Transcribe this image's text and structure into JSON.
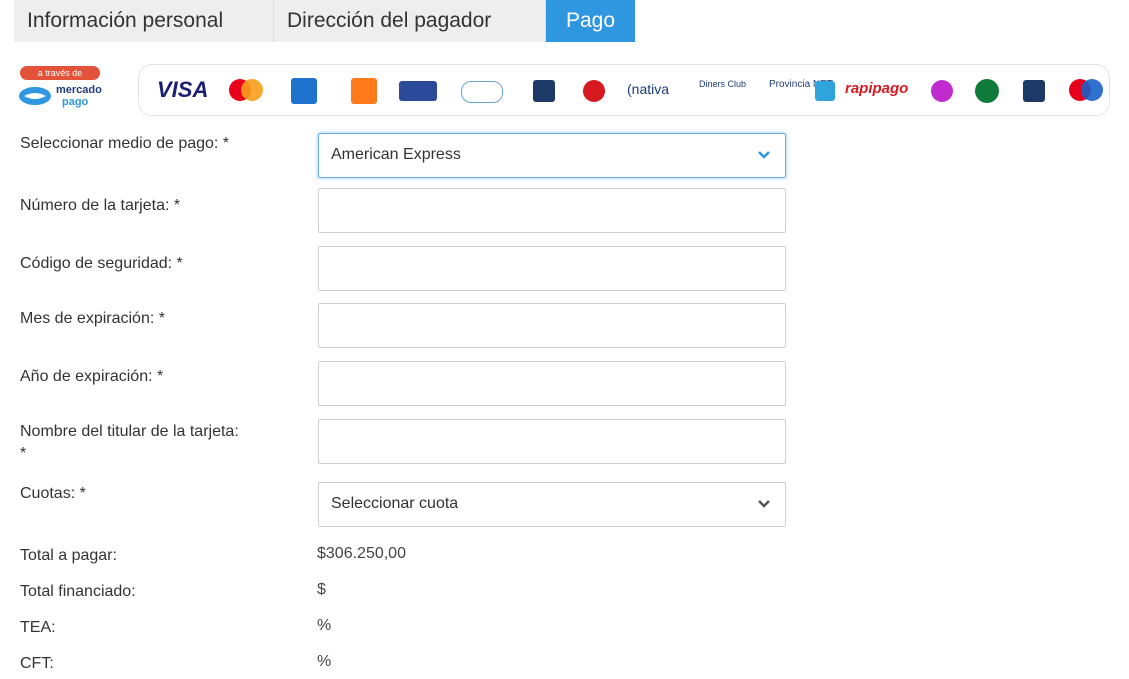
{
  "tabs": [
    {
      "label": "Información personal",
      "active": false
    },
    {
      "label": "Dirección del pagador",
      "active": false
    },
    {
      "label": "Pago",
      "active": true
    }
  ],
  "payment_logos": {
    "mercadopago_badge_top": "a través de",
    "mercadopago_name": "mercado",
    "mercadopago_sub": "pago",
    "brands": [
      "VISA",
      "mastercard",
      "american-express",
      "naranja",
      "tarjeta-shopping",
      "cencosud",
      "cabal",
      "argencard",
      "nativa",
      "Diners Club",
      "Provincia NET",
      "rapipago",
      "pago-facil",
      "link",
      "cabal-debito",
      "maestro"
    ],
    "visa_text": "VISA",
    "nativa_text": "(nativa",
    "diners_text": "Diners Club",
    "provincia_text": "Provincia NET",
    "rapipago_text": "rapipago"
  },
  "form": {
    "payment_method": {
      "label": "Seleccionar medio de pago: *",
      "value": "American Express"
    },
    "card_number": {
      "label": "Número de la tarjeta: *",
      "value": ""
    },
    "security_code": {
      "label": "Código de seguridad: *",
      "value": ""
    },
    "expiry_month": {
      "label": "Mes de expiración: *",
      "value": ""
    },
    "expiry_year": {
      "label": "Año de expiración: *",
      "value": ""
    },
    "holder_name": {
      "label": "Nombre del titular de la tarjeta: *",
      "value": ""
    },
    "installments": {
      "label": "Cuotas: *",
      "value": "Seleccionar cuota"
    }
  },
  "summary": {
    "total_label": "Total a pagar:",
    "total_value": "$306.250,00",
    "financed_label": "Total financiado:",
    "financed_value": "$",
    "tea_label": "TEA:",
    "tea_value": "%",
    "cft_label": "CFT:",
    "cft_value": "%"
  },
  "colors": {
    "accent": "#2f96e0",
    "tab_bg": "#eeeeee",
    "focus_border": "#6aaee6"
  }
}
